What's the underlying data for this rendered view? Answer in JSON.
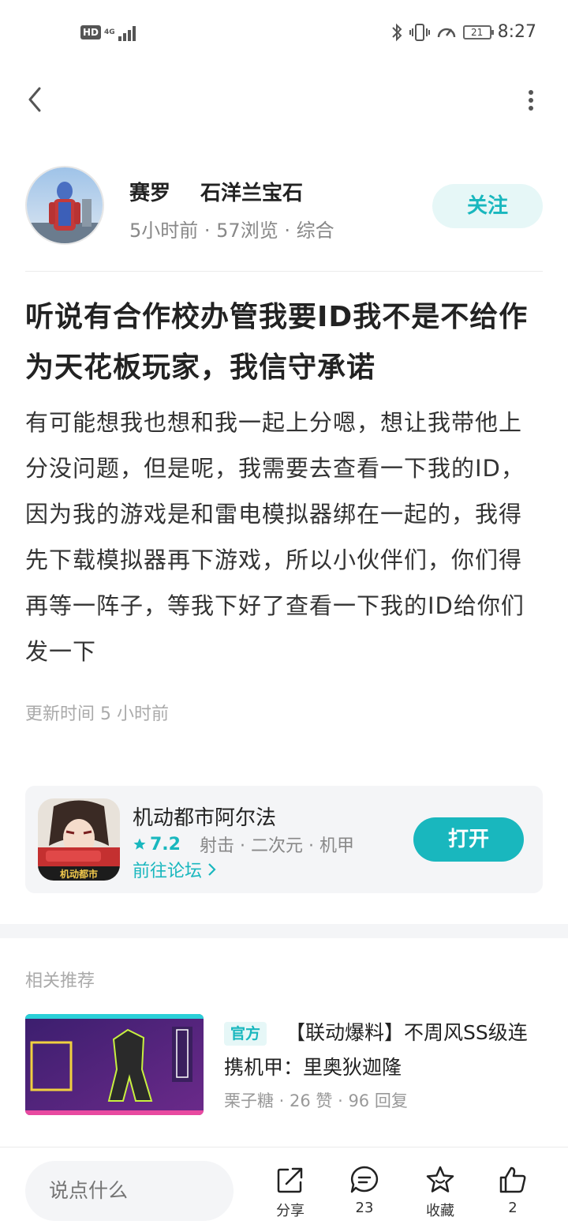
{
  "status_bar": {
    "hd": "HD",
    "network": "4G",
    "battery": "21",
    "time": "8:27"
  },
  "author": {
    "name": "赛罗",
    "tag": "石洋兰宝石",
    "meta": "5小时前 · 57浏览 · 综合",
    "follow_label": "关注"
  },
  "post": {
    "title": "听说有合作校办管我要ID我不是不给作为天花板玩家，我信守承诺",
    "body": "有可能想我也想和我一起上分嗯，想让我带他上分没问题，但是呢，我需要去查看一下我的ID，因为我的游戏是和雷电模拟器绑在一起的，我得先下载模拟器再下游戏，所以小伙伴们，你们得再等一阵子，等我下好了查看一下我的ID给你们发一下",
    "update_time": "更新时间 5 小时前"
  },
  "game": {
    "name": "机动都市阿尔法",
    "score": "7.2",
    "tags": "射击 · 二次元 · 机甲",
    "forum_link": "前往论坛",
    "open_label": "打开",
    "icon_text": "机动都市"
  },
  "related": {
    "section_title": "相关推荐",
    "items": [
      {
        "badge": "官方",
        "headline": "【联动爆料】不周风SS级连携机甲：里奥狄迦隆",
        "meta": "栗子糖 · 26 赞 · 96 回复"
      }
    ]
  },
  "bottom_bar": {
    "comment_placeholder": "说点什么",
    "share_label": "分享",
    "comment_count": "23",
    "collect_label": "收藏",
    "like_count": "2"
  },
  "colors": {
    "accent": "#19b7be",
    "accent_light": "#e6f7f7",
    "card_bg": "#f4f5f7"
  }
}
